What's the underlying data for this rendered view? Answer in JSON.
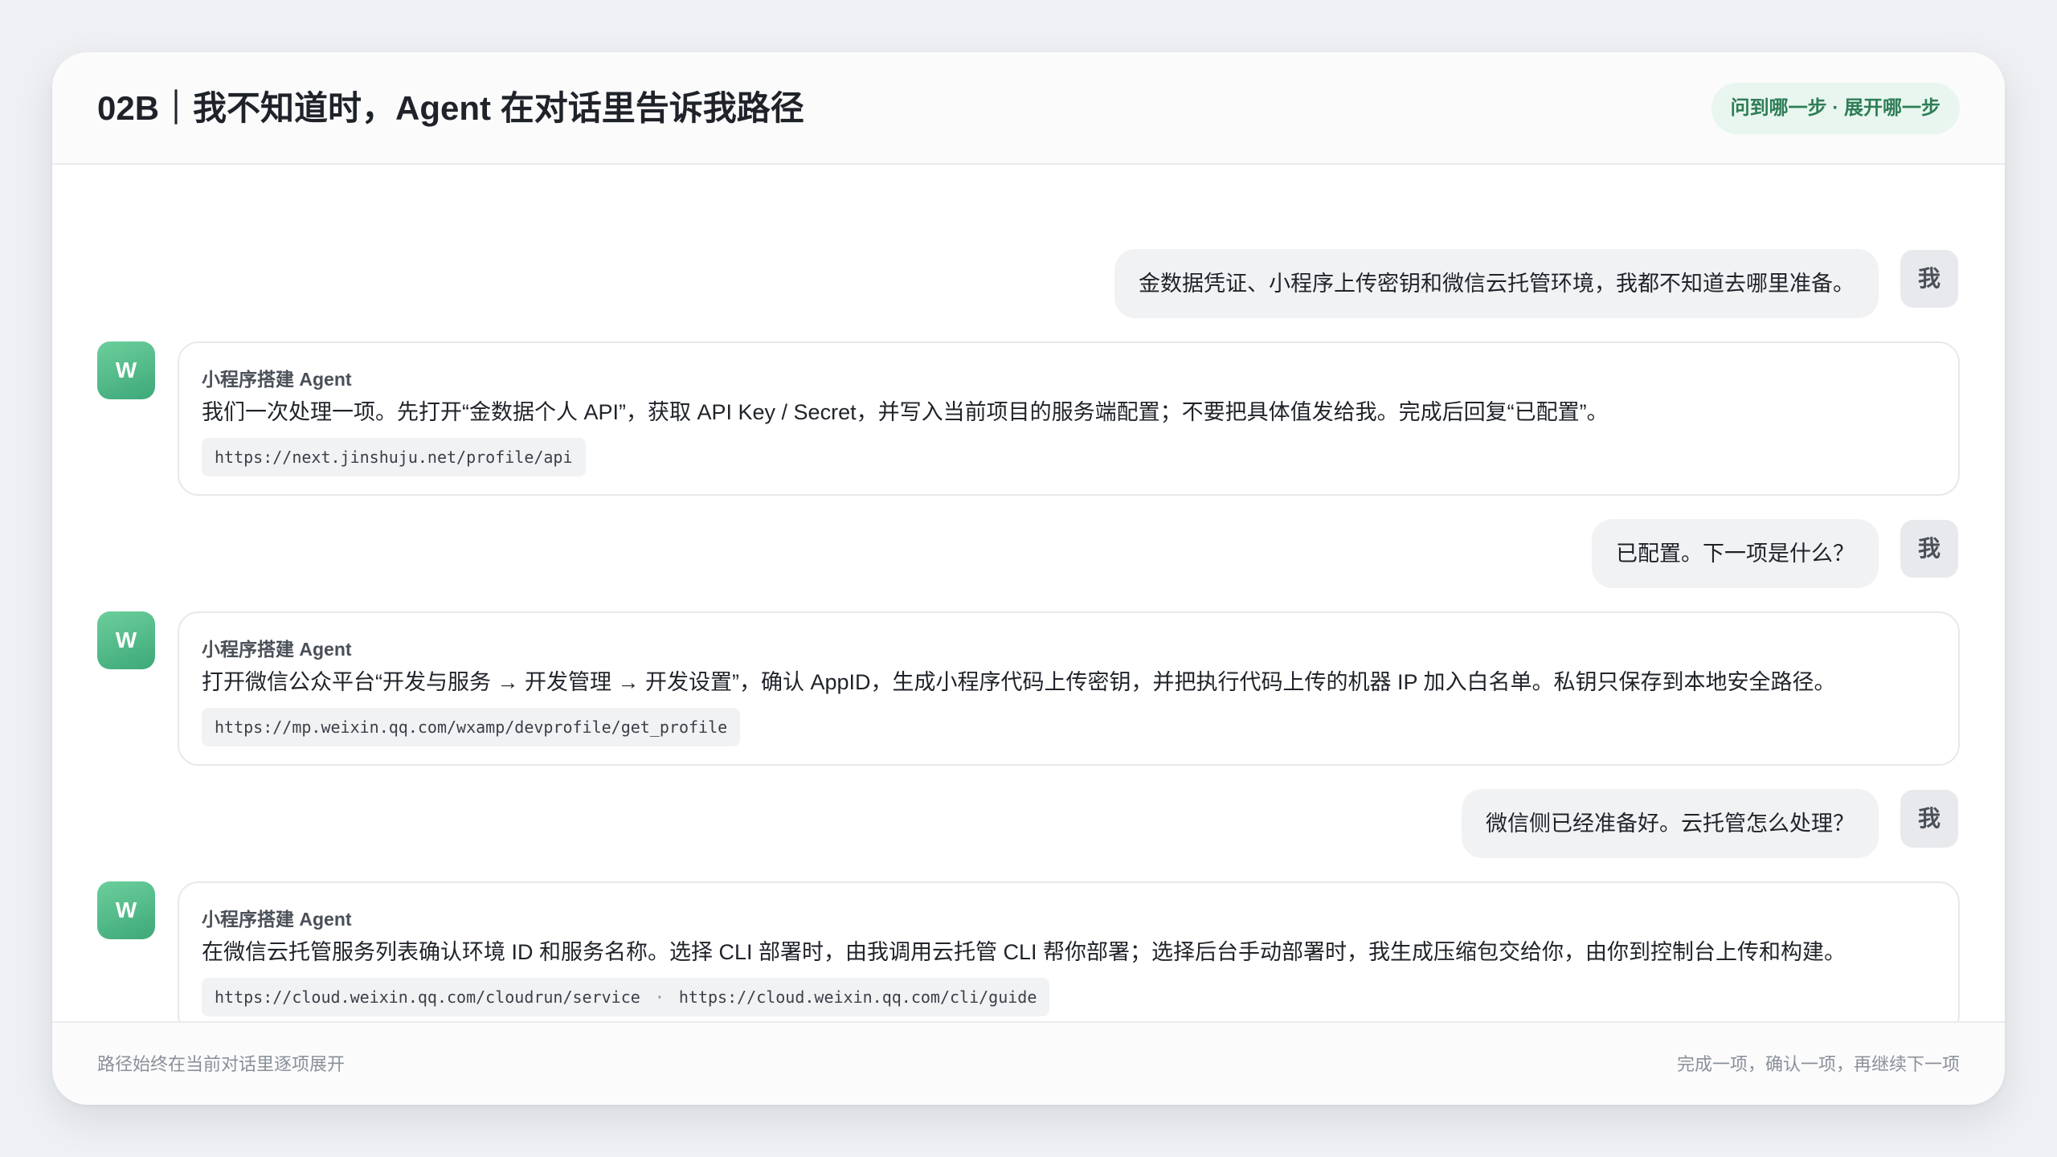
{
  "header": {
    "title": "02B｜我不知道时，Agent 在对话里告诉我路径",
    "badge": "问到哪一步 · 展开哪一步"
  },
  "avatars": {
    "me": "我",
    "agent": "W"
  },
  "agent_name": "小程序搭建 Agent",
  "messages": [
    {
      "role": "user",
      "text": "金数据凭证、小程序上传密钥和微信云托管环境，我都不知道去哪里准备。"
    },
    {
      "role": "agent",
      "text": "我们一次处理一项。先打开“金数据个人 API”，获取 API Key / Secret，并写入当前项目的服务端配置；不要把具体值发给我。完成后回复“已配置”。",
      "links": [
        "https://next.jinshuju.net/profile/api"
      ]
    },
    {
      "role": "user",
      "text": "已配置。下一项是什么？"
    },
    {
      "role": "agent",
      "text": "打开微信公众平台“开发与服务 → 开发管理 → 开发设置”，确认 AppID，生成小程序代码上传密钥，并把执行代码上传的机器 IP 加入白名单。私钥只保存到本地安全路径。",
      "links": [
        "https://mp.weixin.qq.com/wxamp/devprofile/get_profile"
      ]
    },
    {
      "role": "user",
      "text": "微信侧已经准备好。云托管怎么处理？"
    },
    {
      "role": "agent",
      "text": "在微信云托管服务列表确认环境 ID 和服务名称。选择 CLI 部署时，由我调用云托管 CLI 帮你部署；选择后台手动部署时，我生成压缩包交给你，由你到控制台上传和构建。",
      "links": [
        "https://cloud.weixin.qq.com/cloudrun/service",
        "https://cloud.weixin.qq.com/cli/guide"
      ],
      "link_separator": "·"
    }
  ],
  "footer": {
    "left": "路径始终在当前对话里逐项展开",
    "right": "完成一项，确认一项，再继续下一项"
  },
  "colors": {
    "accent": "#3ea879",
    "badge_bg": "#e8f6ef",
    "badge_text": "#2e7d57",
    "user_bubble": "#f1f2f4"
  }
}
